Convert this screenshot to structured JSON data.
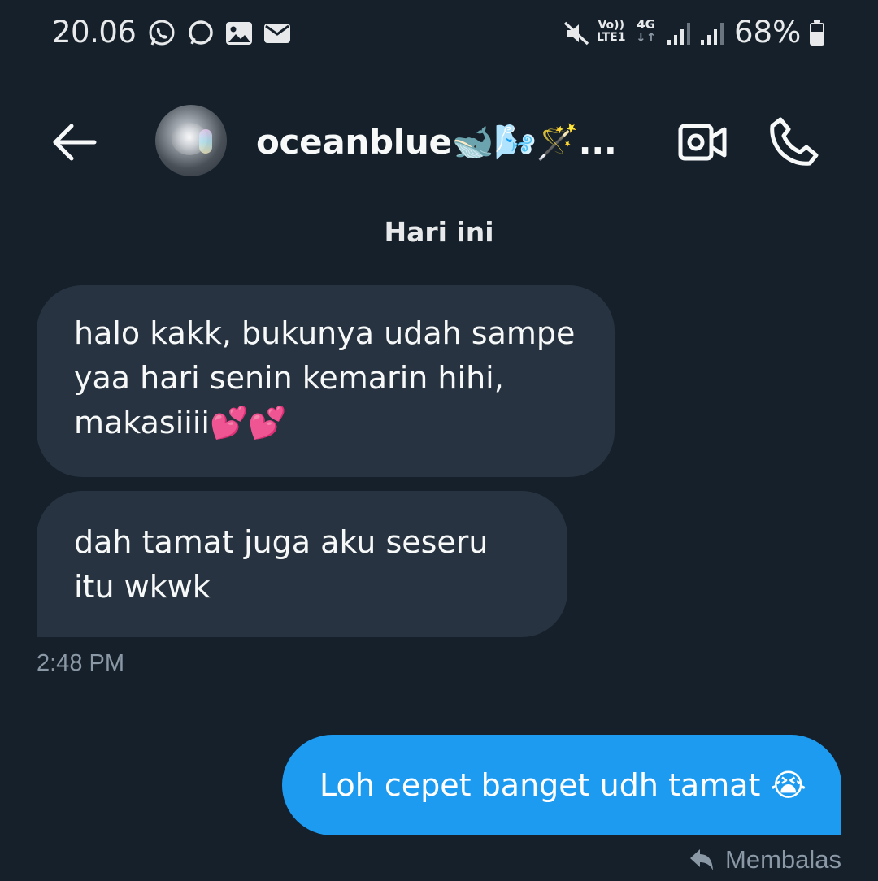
{
  "status_bar": {
    "time": "20.06",
    "notification_icons": [
      "whatsapp-icon",
      "chat-bubble-icon",
      "image-icon",
      "mail-icon"
    ],
    "volte_label_top": "Vo))",
    "volte_label_bottom": "LTE1",
    "network_label": "4G",
    "network_arrows": "↓↑",
    "battery_percent": "68%"
  },
  "header": {
    "contact_name": "oceanblue🐋🌬️🪄...",
    "back_icon": "arrow-left-icon",
    "video_icon": "video-camera-icon",
    "call_icon": "phone-icon"
  },
  "conversation": {
    "date_separator": "Hari ini",
    "incoming": [
      {
        "text": "halo kakk, bukunya udah sampe yaa hari senin kemarin hihi, makasiiii💕💕"
      },
      {
        "text": "dah tamat juga aku seseru itu wkwk"
      }
    ],
    "incoming_timestamp": "2:48 PM",
    "outgoing": [
      {
        "text": "Loh cepet banget udh tamat 😭"
      }
    ],
    "reply_label": "Membalas",
    "reply_icon": "reply-arrow-icon"
  },
  "colors": {
    "background": "#15202b",
    "incoming_bubble": "#273340",
    "outgoing_bubble": "#1d9bf0",
    "muted_text": "#8b98a5",
    "primary_text": "#e7e9ea"
  }
}
